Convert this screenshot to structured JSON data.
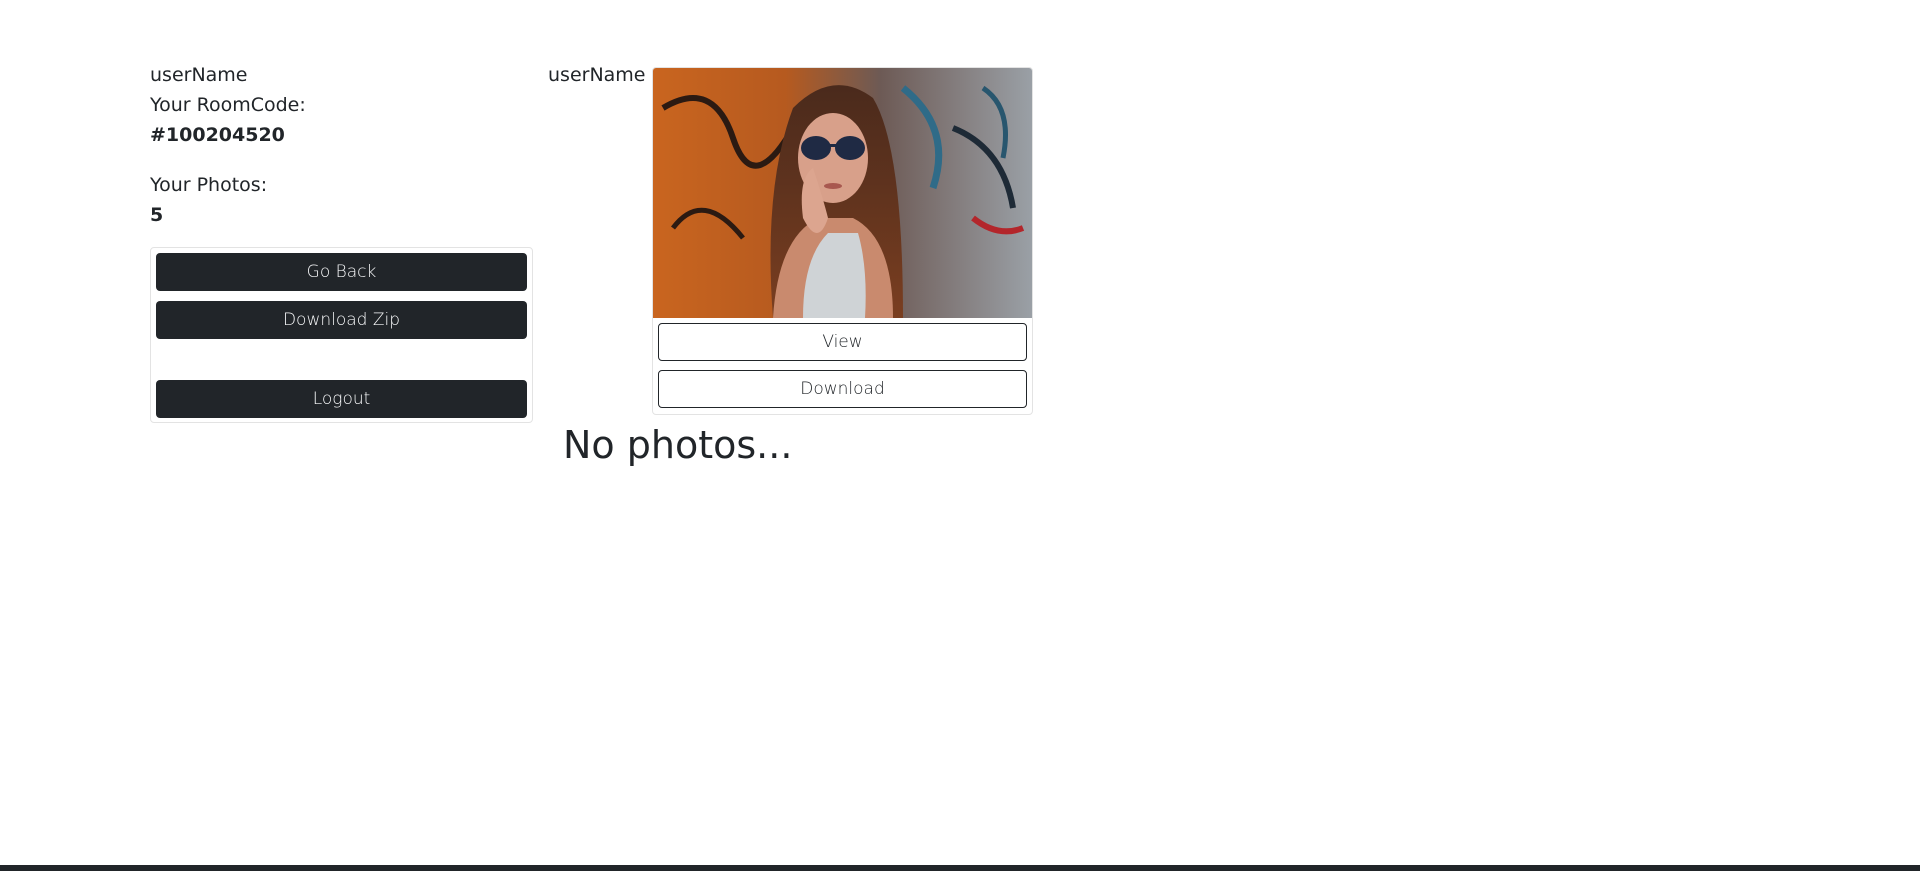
{
  "user": {
    "name": "userName",
    "room_code_label": "Your RoomCode:",
    "room_code": "#100204520",
    "photos_label": "Your Photos:",
    "photos_count": "5"
  },
  "actions": {
    "go_back": "Go Back",
    "download_zip": "Download Zip",
    "logout": "Logout"
  },
  "photo_card": {
    "owner": "userName",
    "view_label": "View",
    "download_label": "Download"
  },
  "empty_message": "No photos...",
  "colors": {
    "dark": "#212529",
    "text": "#212529",
    "border": "#e3e3e3"
  }
}
